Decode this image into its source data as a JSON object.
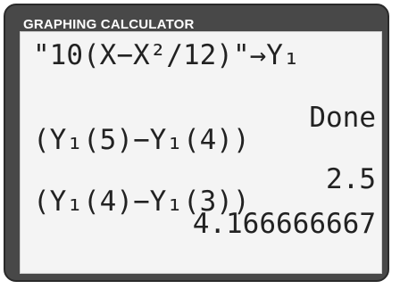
{
  "header": {
    "title": "GRAPHING CALCULATOR"
  },
  "screen": {
    "lines": [
      "\"10(X−X²/12)\"→Y₁",
      "Done",
      "(Y₁(5)−Y₁(4))",
      "2.5",
      "(Y₁(4)−Y₁(3))",
      "4.166666667"
    ]
  }
}
